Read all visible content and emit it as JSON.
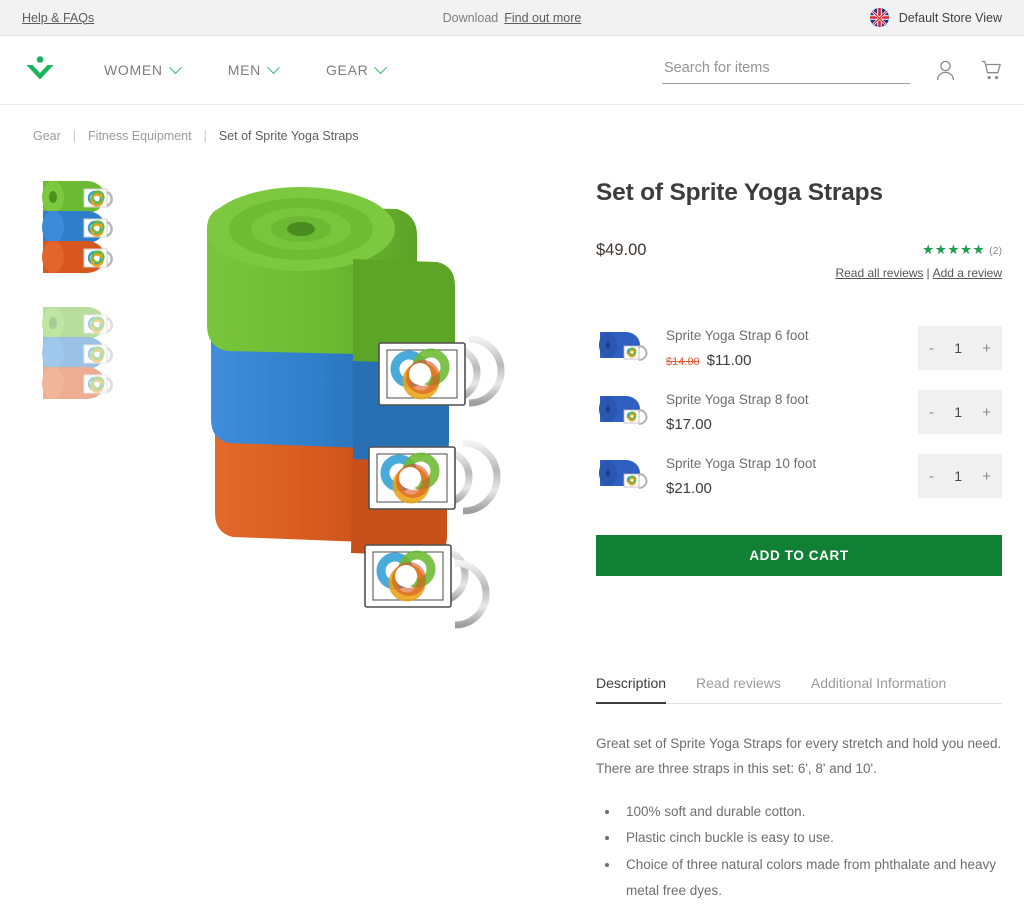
{
  "topbar": {
    "help_link": "Help & FAQs",
    "download_label": "Download",
    "find_out_more": "Find out more",
    "store_view": "Default Store View",
    "flag_icon": "uk-flag-icon"
  },
  "header": {
    "logo_icon": "brand-chevron-logo",
    "nav": [
      {
        "label": "WOMEN",
        "icon": "chevron-down-icon"
      },
      {
        "label": "MEN",
        "icon": "chevron-down-icon"
      },
      {
        "label": "GEAR",
        "icon": "chevron-down-icon"
      }
    ],
    "search": {
      "placeholder": "Search for items",
      "value": "",
      "icon": "search-input"
    },
    "account_icon": "user-account-icon",
    "cart_icon": "shopping-cart-icon"
  },
  "breadcrumb": [
    {
      "label": "Gear",
      "current": false
    },
    {
      "label": "Fitness Equipment",
      "current": false
    },
    {
      "label": "Set of Sprite Yoga Straps",
      "current": true
    }
  ],
  "gallery": {
    "thumbnails": [
      {
        "name": "thumbnail-straps-color",
        "faded": false
      },
      {
        "name": "thumbnail-straps-faded",
        "faded": true
      }
    ],
    "main_image_alt": "Set of three rolled yoga straps in green, blue and orange"
  },
  "product": {
    "title": "Set of Sprite Yoga Straps",
    "price": "$49.00",
    "stars": "★★★★★",
    "rating_count": "(2)",
    "read_all_reviews": "Read all reviews",
    "review_sep": "|",
    "add_a_review": "Add a review",
    "accent_color": "#1f9e4d",
    "button_color": "#0f8034",
    "sale_color": "#e05a33",
    "options": [
      {
        "name": "Sprite Yoga Strap 6 foot",
        "old_price": "$14.00",
        "price": "$11.00",
        "qty": "1",
        "minus": "-",
        "plus": "+"
      },
      {
        "name": "Sprite Yoga Strap 8 foot",
        "old_price": "",
        "price": "$17.00",
        "qty": "1",
        "minus": "-",
        "plus": "+"
      },
      {
        "name": "Sprite Yoga Strap 10 foot",
        "old_price": "",
        "price": "$21.00",
        "qty": "1",
        "minus": "-",
        "plus": "+"
      }
    ],
    "add_to_cart": "ADD TO CART"
  },
  "tabs": [
    {
      "label": "Description",
      "active": true
    },
    {
      "label": "Read reviews",
      "active": false
    },
    {
      "label": "Additional Information",
      "active": false
    }
  ],
  "description": {
    "paragraph": "Great set of Sprite Yoga Straps for every stretch and hold you need. There are three straps in this set: 6', 8' and 10'.",
    "bullets": [
      "100% soft and durable cotton.",
      "Plastic cinch buckle is easy to use.",
      "Choice of three natural colors made from phthalate and heavy metal free dyes."
    ]
  }
}
